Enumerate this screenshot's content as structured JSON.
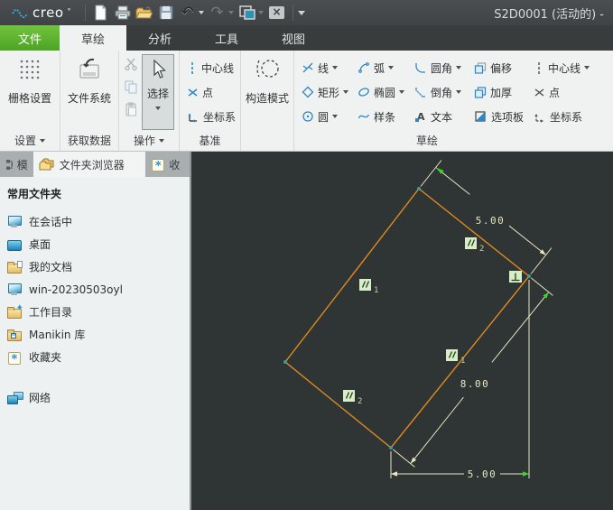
{
  "titlebar": {
    "logo_text": "creo",
    "title": "S2D0001 (活动的) -"
  },
  "tabs": {
    "file": "文件",
    "sketch": "草绘",
    "analysis": "分析",
    "tools": "工具",
    "view": "视图"
  },
  "ribbon": {
    "settings": {
      "button": "栅格设置",
      "label": "设置"
    },
    "get_data": {
      "button": "文件系统",
      "label": "获取数据"
    },
    "operations": {
      "select": "选择",
      "label": "操作"
    },
    "datum": {
      "centerline": "中心线",
      "point": "点",
      "csys": "坐标系",
      "label": "基准"
    },
    "construction": {
      "button": "构造模式"
    },
    "sketch": {
      "label": "草绘",
      "line": "线",
      "rect": "矩形",
      "circle": "圆",
      "arc": "弧",
      "ellipse": "椭圆",
      "spline": "样条",
      "fillet": "圆角",
      "chamfer": "倒角",
      "text": "文本",
      "offset": "偏移",
      "thicken": "加厚",
      "palette": "选项板",
      "centerline": "中心线",
      "point": "点",
      "csys": "坐标系"
    }
  },
  "sidebar": {
    "tabs": {
      "model_tree": "模",
      "folder_browser": "文件夹浏览器",
      "favorites": "收"
    },
    "header": "常用文件夹",
    "items": [
      {
        "label": "在会话中"
      },
      {
        "label": "桌面"
      },
      {
        "label": "我的文档"
      },
      {
        "label": "win-20230503oyl"
      },
      {
        "label": "工作目录"
      },
      {
        "label": "Manikin 库"
      },
      {
        "label": "收藏夹"
      },
      {
        "label": "网络"
      }
    ]
  },
  "canvas": {
    "dimensions": {
      "top_edge": "5.00",
      "right_edge": "8.00",
      "bottom_edge": "5.00"
    },
    "constraints": {
      "perpendicular": "⊥",
      "parallel_sub_1": "1",
      "parallel_sub_2": "2"
    },
    "colors": {
      "background": "#2f3434",
      "sketch_line": "#df8a1f",
      "dimension": "#e9e6c0",
      "highlight_green": "#3ed42c",
      "vertex_dot": "#3e9aa2",
      "constraint_badge": "#d9eec6"
    }
  }
}
